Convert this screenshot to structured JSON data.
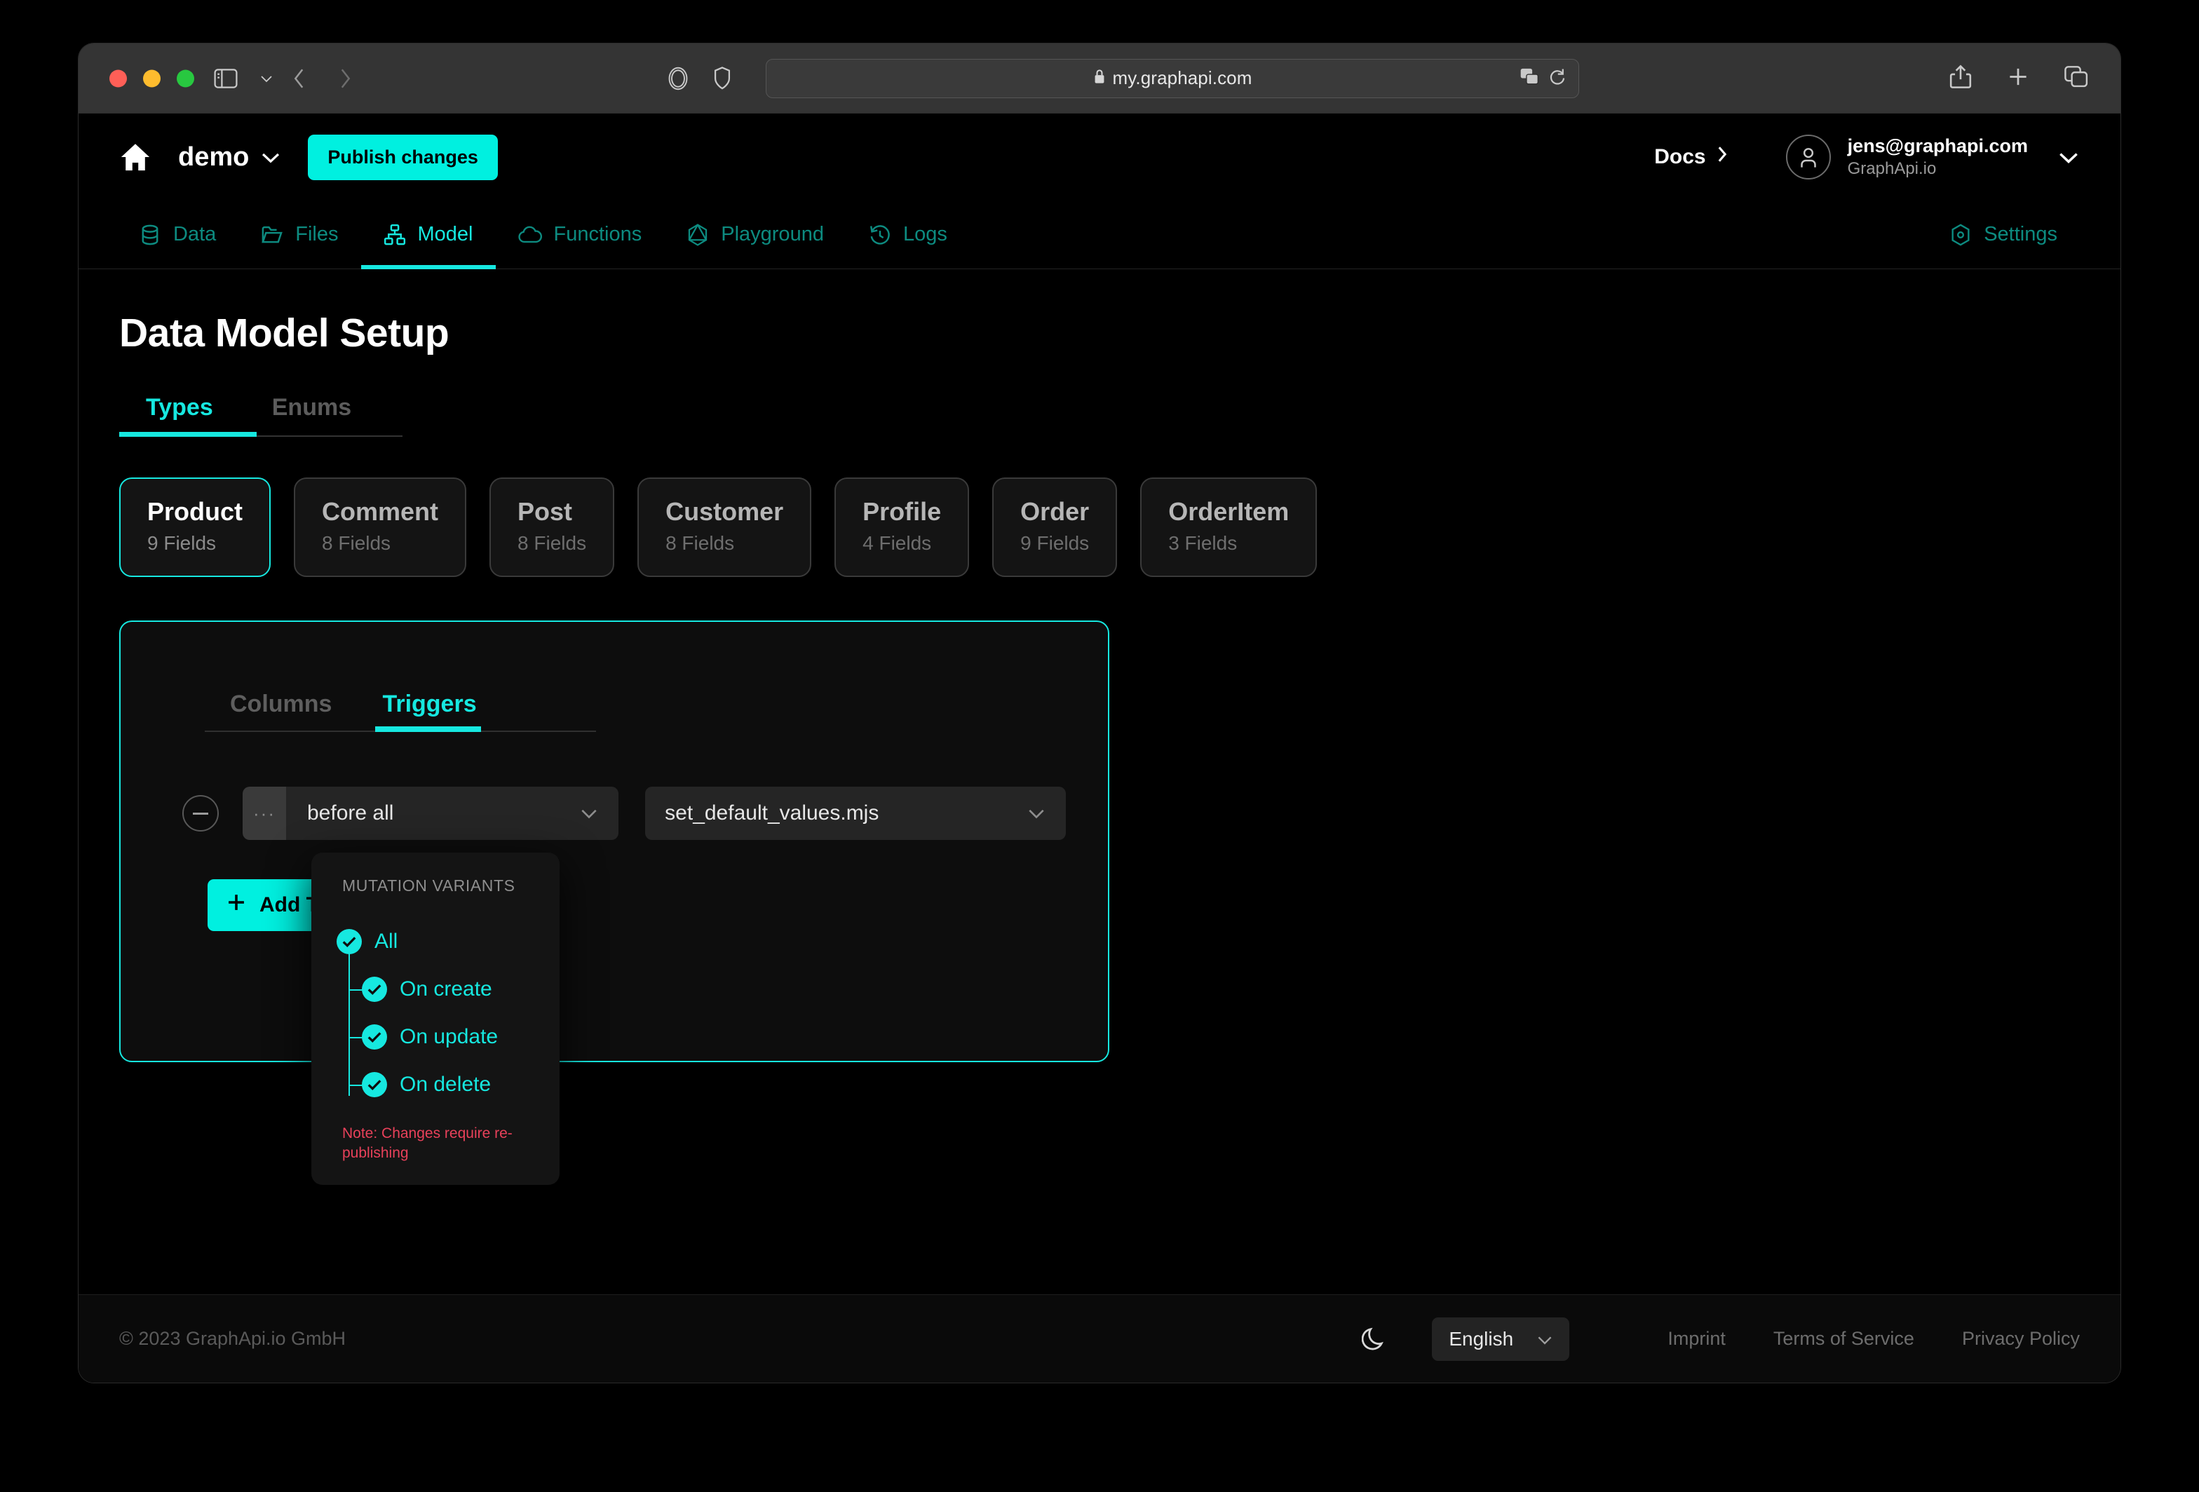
{
  "browser": {
    "url": "my.graphapi.com",
    "lock_icon": "lock-icon",
    "translate_icon": "translate-icon",
    "reload_icon": "reload-icon",
    "share_icon": "share-icon",
    "new_tab_icon": "plus-icon",
    "tabs_icon": "tab-overview-icon",
    "sidebar_icon": "sidebar-toggle-icon",
    "back_icon": "chevron-left-icon",
    "forward_icon": "chevron-right-icon",
    "globe_icon": "globe-icon"
  },
  "header": {
    "home_icon": "home-icon",
    "project": "demo",
    "project_caret": "chevron-down-icon",
    "publish_label": "Publish changes",
    "docs_label": "Docs",
    "docs_caret": "chevron-right-icon",
    "avatar_icon": "user-avatar-icon",
    "user_email": "jens@graphapi.com",
    "user_org": "GraphApi.io",
    "user_caret": "chevron-down-icon"
  },
  "nav": {
    "items": [
      {
        "label": "Data",
        "icon": "database-icon",
        "active": false
      },
      {
        "label": "Files",
        "icon": "folder-icon",
        "active": false
      },
      {
        "label": "Model",
        "icon": "sitemap-icon",
        "active": true
      },
      {
        "label": "Functions",
        "icon": "cloud-icon",
        "active": false
      },
      {
        "label": "Playground",
        "icon": "graphql-icon",
        "active": false
      },
      {
        "label": "Logs",
        "icon": "history-icon",
        "active": false
      }
    ],
    "settings_label": "Settings",
    "settings_icon": "gear-hexagon-icon"
  },
  "page": {
    "title": "Data Model Setup",
    "subtabs": [
      {
        "label": "Types",
        "active": true
      },
      {
        "label": "Enums",
        "active": false
      }
    ]
  },
  "type_cards": [
    {
      "name": "Product",
      "fields": "9 Fields",
      "selected": true
    },
    {
      "name": "Comment",
      "fields": "8 Fields",
      "selected": false
    },
    {
      "name": "Post",
      "fields": "8 Fields",
      "selected": false
    },
    {
      "name": "Customer",
      "fields": "8 Fields",
      "selected": false
    },
    {
      "name": "Profile",
      "fields": "4 Fields",
      "selected": false
    },
    {
      "name": "Order",
      "fields": "9 Fields",
      "selected": false
    },
    {
      "name": "OrderItem",
      "fields": "3 Fields",
      "selected": false
    }
  ],
  "detail": {
    "tabs": [
      {
        "label": "Columns",
        "active": false
      },
      {
        "label": "Triggers",
        "active": true
      }
    ],
    "trigger": {
      "remove_icon": "minus-circle-icon",
      "drag_handle_icon": "drag-handle-icon",
      "when_value": "before all",
      "when_caret": "chevron-down-icon",
      "function_value": "set_default_values.mjs",
      "function_caret": "chevron-down-icon"
    },
    "add_trigger_label": "Add Trigger",
    "add_trigger_icon": "plus-icon"
  },
  "popover": {
    "title": "MUTATION VARIANTS",
    "variants": [
      {
        "label": "All",
        "checked": true,
        "child": false
      },
      {
        "label": "On create",
        "checked": true,
        "child": true
      },
      {
        "label": "On update",
        "checked": true,
        "child": true
      },
      {
        "label": "On delete",
        "checked": true,
        "child": true
      }
    ],
    "note": "Note: Changes require re-publishing",
    "check_icon": "check-circle-icon"
  },
  "footer": {
    "copyright": "© 2023 GraphApi.io GmbH",
    "theme_icon": "moon-icon",
    "language": "English",
    "language_caret": "chevron-down-icon",
    "links": [
      "Imprint",
      "Terms of Service",
      "Privacy Policy"
    ]
  },
  "colors": {
    "accent": "#16e8e0",
    "accent_button": "#00f0e0",
    "note_red": "#e8415a",
    "nav_teal": "#0d8b80",
    "background": "#000000"
  }
}
